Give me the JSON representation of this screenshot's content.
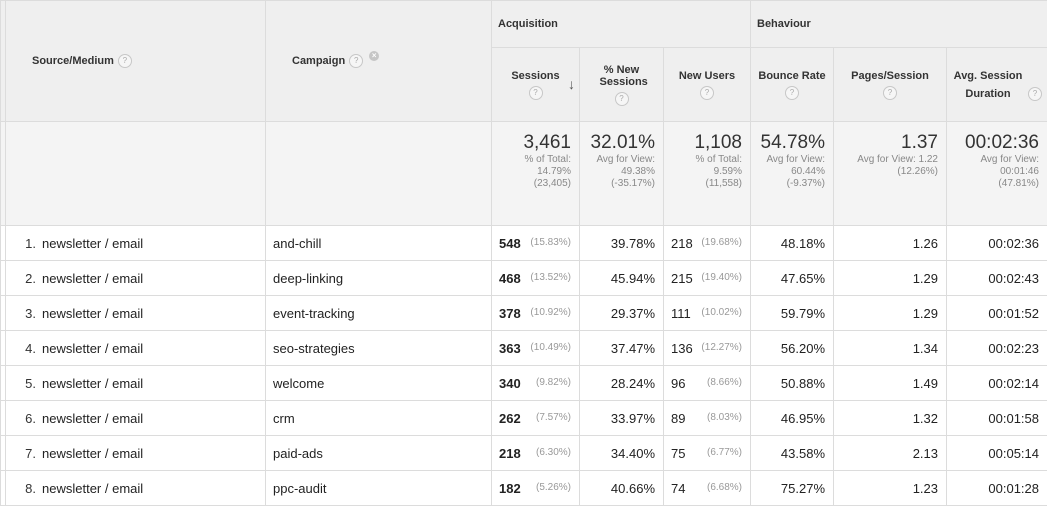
{
  "header": {
    "source_medium": "Source/Medium",
    "campaign": "Campaign",
    "group_acquisition": "Acquisition",
    "group_behaviour": "Behaviour",
    "sessions": "Sessions",
    "pct_new_sessions": "% New Sessions",
    "new_users": "New Users",
    "bounce_rate": "Bounce Rate",
    "pages_session": "Pages/Session",
    "avg_session_duration": "Avg. Session Duration",
    "help_glyph": "?",
    "remove_glyph": "×",
    "sort_glyph": "↓"
  },
  "totals": {
    "sessions": {
      "value": "3,461",
      "l1": "% of Total:",
      "l2": "14.79%",
      "l3": "(23,405)"
    },
    "pct_new": {
      "value": "32.01%",
      "l1": "Avg for View:",
      "l2": "49.38%",
      "l3": "(-35.17%)"
    },
    "new_users": {
      "value": "1,108",
      "l1": "% of Total:",
      "l2": "9.59%",
      "l3": "(11,558)"
    },
    "bounce": {
      "value": "54.78%",
      "l1": "Avg for View:",
      "l2": "60.44%",
      "l3": "(-9.37%)"
    },
    "pages": {
      "value": "1.37",
      "l1": "Avg for View: 1.22",
      "l2": "(12.26%)",
      "l3": ""
    },
    "duration": {
      "value": "00:02:36",
      "l1": "Avg for View:",
      "l2": "00:01:46",
      "l3": "(47.81%)"
    }
  },
  "rows": [
    {
      "idx": "1.",
      "source": "newsletter / email",
      "campaign": "and-chill",
      "sessions": "548",
      "sessions_pct": "(15.83%)",
      "pct_new": "39.78%",
      "new_users": "218",
      "new_users_pct": "(19.68%)",
      "bounce": "48.18%",
      "pages": "1.26",
      "duration": "00:02:36"
    },
    {
      "idx": "2.",
      "source": "newsletter / email",
      "campaign": "deep-linking",
      "sessions": "468",
      "sessions_pct": "(13.52%)",
      "pct_new": "45.94%",
      "new_users": "215",
      "new_users_pct": "(19.40%)",
      "bounce": "47.65%",
      "pages": "1.29",
      "duration": "00:02:43"
    },
    {
      "idx": "3.",
      "source": "newsletter / email",
      "campaign": "event-tracking",
      "sessions": "378",
      "sessions_pct": "(10.92%)",
      "pct_new": "29.37%",
      "new_users": "111",
      "new_users_pct": "(10.02%)",
      "bounce": "59.79%",
      "pages": "1.29",
      "duration": "00:01:52"
    },
    {
      "idx": "4.",
      "source": "newsletter / email",
      "campaign": "seo-strategies",
      "sessions": "363",
      "sessions_pct": "(10.49%)",
      "pct_new": "37.47%",
      "new_users": "136",
      "new_users_pct": "(12.27%)",
      "bounce": "56.20%",
      "pages": "1.34",
      "duration": "00:02:23"
    },
    {
      "idx": "5.",
      "source": "newsletter / email",
      "campaign": "welcome",
      "sessions": "340",
      "sessions_pct": "(9.82%)",
      "pct_new": "28.24%",
      "new_users": "96",
      "new_users_pct": "(8.66%)",
      "bounce": "50.88%",
      "pages": "1.49",
      "duration": "00:02:14"
    },
    {
      "idx": "6.",
      "source": "newsletter / email",
      "campaign": "crm",
      "sessions": "262",
      "sessions_pct": "(7.57%)",
      "pct_new": "33.97%",
      "new_users": "89",
      "new_users_pct": "(8.03%)",
      "bounce": "46.95%",
      "pages": "1.32",
      "duration": "00:01:58"
    },
    {
      "idx": "7.",
      "source": "newsletter / email",
      "campaign": "paid-ads",
      "sessions": "218",
      "sessions_pct": "(6.30%)",
      "pct_new": "34.40%",
      "new_users": "75",
      "new_users_pct": "(6.77%)",
      "bounce": "43.58%",
      "pages": "2.13",
      "duration": "00:05:14"
    },
    {
      "idx": "8.",
      "source": "newsletter / email",
      "campaign": "ppc-audit",
      "sessions": "182",
      "sessions_pct": "(5.26%)",
      "pct_new": "40.66%",
      "new_users": "74",
      "new_users_pct": "(6.68%)",
      "bounce": "75.27%",
      "pages": "1.23",
      "duration": "00:01:28"
    }
  ]
}
